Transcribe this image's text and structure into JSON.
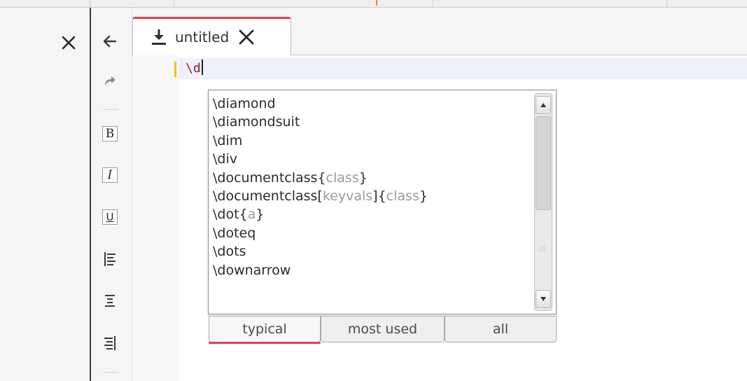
{
  "colors": {
    "accent": "#e0424a",
    "change_marker": "#f3c300",
    "top_marker": "#f08a24",
    "command_text": "#9c1a1a",
    "placeholder_text": "#9a9a9a",
    "current_line": "#eef0fb"
  },
  "icons": {
    "close_panel": "close-icon",
    "back": "arrow-left-icon",
    "forward": "redo-arrow-icon",
    "align_left": "align-left-icon",
    "align_center": "align-center-icon",
    "align_right": "align-right-icon",
    "tab_download": "download-icon",
    "tab_close": "close-icon"
  },
  "toolbar": {
    "bold_label": "B",
    "italic_label": "I",
    "underline_label": "U"
  },
  "tab": {
    "title": "untitled"
  },
  "editor": {
    "line_text": "\\d"
  },
  "completer": {
    "items": [
      {
        "cmd": "\\diamond"
      },
      {
        "cmd": "\\diamondsuit"
      },
      {
        "cmd": "\\dim"
      },
      {
        "cmd": "\\div"
      },
      {
        "cmd": "\\documentclass{",
        "p1": "class",
        "t1": "}"
      },
      {
        "cmd": "\\documentclass[",
        "p1": "keyvals",
        "t1": "]{",
        "p2": "class",
        "t2": "}"
      },
      {
        "cmd": "\\dot{",
        "p1": "a",
        "t1": "}"
      },
      {
        "cmd": "\\doteq"
      },
      {
        "cmd": "\\dots"
      },
      {
        "cmd": "\\downarrow"
      }
    ],
    "filter_tabs": [
      {
        "label": "typical",
        "active": true
      },
      {
        "label": "most used",
        "active": false
      },
      {
        "label": "all",
        "active": false
      }
    ]
  }
}
